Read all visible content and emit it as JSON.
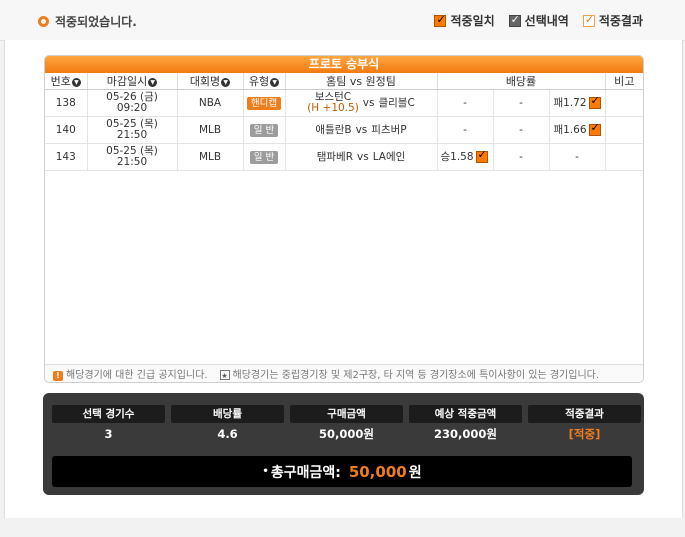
{
  "status": {
    "text": "적중되었습니다."
  },
  "legend": [
    {
      "label": "적중일치",
      "style": "dark"
    },
    {
      "label": "선택내역",
      "style": "gray"
    },
    {
      "label": "적중결과",
      "style": "outline"
    }
  ],
  "panel": {
    "title": "프로토 승부식",
    "columns": [
      "번호",
      "마감일시",
      "대회명",
      "유형",
      "홈팀 vs 원정팀",
      "배당률",
      "비고"
    ],
    "rows": [
      {
        "num": "138",
        "date": "05-26 (금)",
        "time": "09:20",
        "league": "NBA",
        "type": "핸디캡",
        "type_style": "hcp",
        "home": "보스턴C",
        "handicap": "(H +10.5)",
        "vs": "vs",
        "away": "클리블C",
        "odd_win": "-",
        "odd_draw": "-",
        "odd_lose": "패1.72",
        "pick": "lose",
        "note": ""
      },
      {
        "num": "140",
        "date": "05-25 (목)",
        "time": "21:50",
        "league": "MLB",
        "type": "일 반",
        "type_style": "normal",
        "home": "애틀란B",
        "handicap": "",
        "vs": "vs",
        "away": "피츠버P",
        "odd_win": "-",
        "odd_draw": "-",
        "odd_lose": "패1.66",
        "pick": "lose",
        "note": ""
      },
      {
        "num": "143",
        "date": "05-25 (목)",
        "time": "21:50",
        "league": "MLB",
        "type": "일 반",
        "type_style": "normal",
        "home": "탬파베R",
        "handicap": "",
        "vs": "vs",
        "away": "LA에인",
        "odd_win": "승1.58",
        "odd_draw": "-",
        "odd_lose": "-",
        "pick": "win",
        "note": ""
      }
    ],
    "notice1": "해당경기에 대한 긴급 공지입니다.",
    "notice2": "해당경기는 중립경기장 및 제2구장, 타 지역 등 경기장소에 특이사항이 있는 경기입니다."
  },
  "summary": {
    "labels": [
      "선택 경기수",
      "배당률",
      "구매금액",
      "예상 적중금액",
      "적중결과"
    ],
    "values": [
      "3",
      "4.6",
      "50,000원",
      "230,000원",
      "[적중]"
    ],
    "total_label": "총구매금액:",
    "total_amount": "50,000",
    "total_unit": "원"
  },
  "colors": {
    "accent": "#f07d1c",
    "dark": "#3a3a3a"
  }
}
